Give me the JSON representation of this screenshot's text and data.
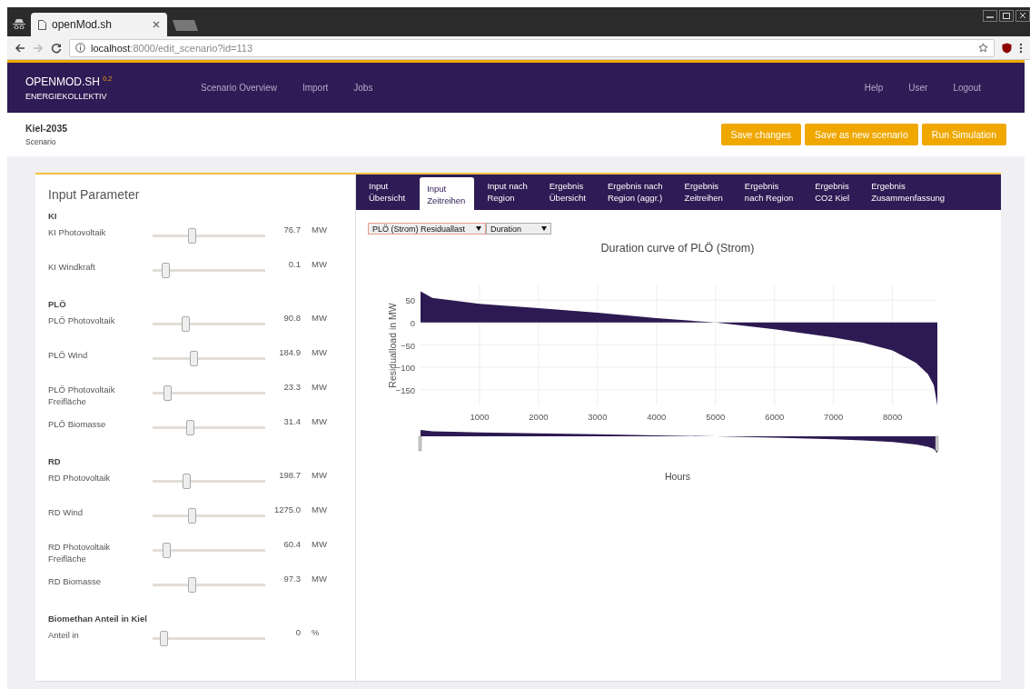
{
  "browser": {
    "tab_title": "openMod.sh",
    "url_host": "localhost",
    "url_path": ":8000/edit_scenario?id=113"
  },
  "navbar": {
    "brand": "OPENMOD.SH",
    "version": "0.2",
    "subtitle": "ENERGIEKOLLEKTIV",
    "links": [
      "Scenario Overview",
      "Import",
      "Jobs"
    ],
    "right_links": [
      "Help",
      "User",
      "Logout"
    ]
  },
  "scenario": {
    "name": "Kiel-2035",
    "label": "Scenario",
    "buttons": [
      "Save changes",
      "Save as new scenario",
      "Run Simulation"
    ]
  },
  "input_panel": {
    "title": "Input Parameter",
    "groups": [
      {
        "title": "KI",
        "params": [
          {
            "label": "KI Photovoltaik",
            "level": 0.35,
            "value": "76.7",
            "unit": "MW"
          },
          {
            "label": "KI Windkraft",
            "level": 0.11,
            "value": "0.1",
            "unit": "MW"
          }
        ]
      },
      {
        "title": "PLÖ",
        "params": [
          {
            "label": "PLÖ Photovoltaik",
            "level": 0.29,
            "value": "90.8",
            "unit": "MW"
          },
          {
            "label": "PLÖ Wind",
            "level": 0.36,
            "value": "184.9",
            "unit": "MW"
          },
          {
            "label": "PLÖ Photovoltaik Freifläche",
            "level": 0.13,
            "value": "23.3",
            "unit": "MW"
          },
          {
            "label": "PLÖ Biomasse",
            "level": 0.33,
            "value": "31.4",
            "unit": "MW"
          }
        ]
      },
      {
        "title": "RD",
        "params": [
          {
            "label": "RD Photovoltaik",
            "level": 0.3,
            "value": "198.7",
            "unit": "MW"
          },
          {
            "label": "RD Wind",
            "level": 0.35,
            "value": "1275.0",
            "unit": "MW"
          },
          {
            "label": "RD Photovoltaik Freifläche",
            "level": 0.12,
            "value": "60.4",
            "unit": "MW"
          },
          {
            "label": "RD Biomasse",
            "level": 0.35,
            "value": "97.3",
            "unit": "MW"
          }
        ]
      },
      {
        "title": "Biomethan Anteil in Kiel",
        "params": [
          {
            "label": "Anteil in",
            "level": 0.1,
            "value": "0",
            "unit": "%"
          }
        ]
      }
    ]
  },
  "tabs": [
    {
      "label": "Input\nÜbersicht",
      "selected": false
    },
    {
      "label": "Input\nZeitreihen",
      "selected": true
    },
    {
      "label": "Input nach\nRegion",
      "selected": false
    },
    {
      "label": "Ergebnis\nÜbersicht",
      "selected": false
    },
    {
      "label": "Ergebnis nach\nRegion (aggr.)",
      "selected": false
    },
    {
      "label": "Ergebnis\nZeitreihen",
      "selected": false
    },
    {
      "label": "Ergebnis\nnach Region",
      "selected": false
    },
    {
      "label": "Ergebnis\nCO2 Kiel",
      "selected": false
    },
    {
      "label": "Ergebnis\nZusammenfassung",
      "selected": false
    }
  ],
  "selects": [
    "PLÖ (Strom) Residuallast",
    "Duration"
  ],
  "chart": {
    "chart_data": {
      "type": "area",
      "title": "Duration curve of PLÖ (Strom)",
      "ylabel": "Residualload in MW",
      "grid": true,
      "annotations": [
        "Hours"
      ],
      "x": [
        0,
        200,
        1000,
        2000,
        3000,
        4000,
        5000,
        6000,
        7000,
        7500,
        8000,
        8400,
        8600,
        8700,
        8760
      ],
      "series": [
        {
          "color": "#2e1a52",
          "values": [
            70,
            55,
            42,
            32,
            22,
            10,
            0,
            -15,
            -33,
            -45,
            -62,
            -90,
            -115,
            -140,
            -185
          ]
        }
      ],
      "xlim": [
        0,
        8760
      ],
      "ylim": [
        -185,
        85
      ],
      "xticks": [
        1000,
        2000,
        3000,
        4000,
        5000,
        6000,
        7000,
        8000
      ],
      "yticks": [
        {
          "value": 50,
          "label": "50"
        },
        {
          "value": 0,
          "label": "0"
        },
        {
          "value": -50,
          "label": "−50"
        },
        {
          "value": -100,
          "label": "−100"
        },
        {
          "value": -150,
          "label": "−150"
        }
      ]
    }
  }
}
